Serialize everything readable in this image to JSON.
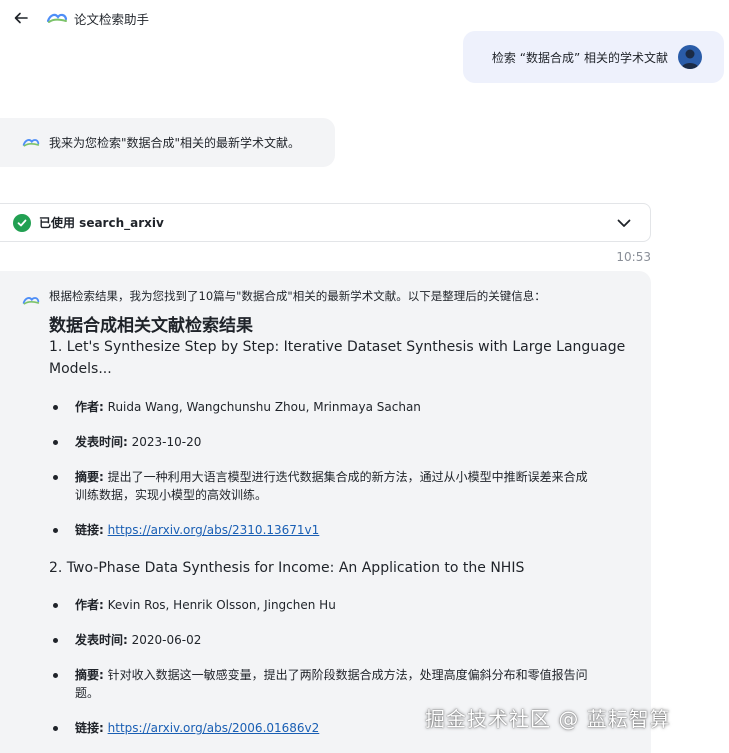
{
  "header": {
    "back_icon": "arrow-left-icon",
    "logo_icon": "cloud-logo-icon",
    "title": "论文检索助手"
  },
  "user_message": {
    "text": "检索 “数据合成” 相关的学术文献",
    "avatar_icon": "user-avatar-icon"
  },
  "assistant_intro": {
    "text": "我来为您检索\"数据合成\"相关的最新学术文献。"
  },
  "tool_call": {
    "status_icon": "check-circle-icon",
    "label": "已使用 search_arxiv",
    "toggle_icon": "chevron-down-icon"
  },
  "timestamp": "10:53",
  "response": {
    "intro": "根据检索结果，我为您找到了10篇与\"数据合成\"相关的最新学术文献。以下是整理后的关键信息：",
    "heading": "数据合成相关文献检索结果",
    "papers": [
      {
        "title_line1": "1. Let's Synthesize Step by Step: Iterative Dataset Synthesis with Large Language",
        "title_line2": "Models...",
        "author_key": "作者:",
        "authors": "Ruida Wang, Wangchunshu Zhou, Mrinmaya Sachan",
        "date_key": "发表时间:",
        "date": "2023-10-20",
        "abstract_key": "摘要:",
        "abstract_line1": "提出了一种利用大语言模型进行迭代数据集合成的新方法，通过从小模型中推断误差来合成",
        "abstract_line2": "训练数据，实现小模型的高效训练。",
        "link_key": "链接:",
        "link": "https://arxiv.org/abs/2310.13671v1"
      },
      {
        "title_line1": "2. Two-Phase Data Synthesis for Income: An Application to the NHIS",
        "author_key": "作者:",
        "authors": "Kevin Ros, Henrik Olsson, Jingchen Hu",
        "date_key": "发表时间:",
        "date": "2020-06-02",
        "abstract_key": "摘要:",
        "abstract_line1": "针对收入数据这一敏感变量，提出了两阶段数据合成方法，处理高度偏斜分布和零值报告问",
        "abstract_line2": "题。",
        "link_key": "链接:",
        "link": "https://arxiv.org/abs/2006.01686v2"
      }
    ]
  },
  "watermark": "掘金技术社区 @ 蓝耘智算",
  "colors": {
    "user_bubble": "#eef1fc",
    "assistant_bubble": "#f3f4f6",
    "success_green": "#22a052",
    "link_blue": "#1a5fb4"
  }
}
